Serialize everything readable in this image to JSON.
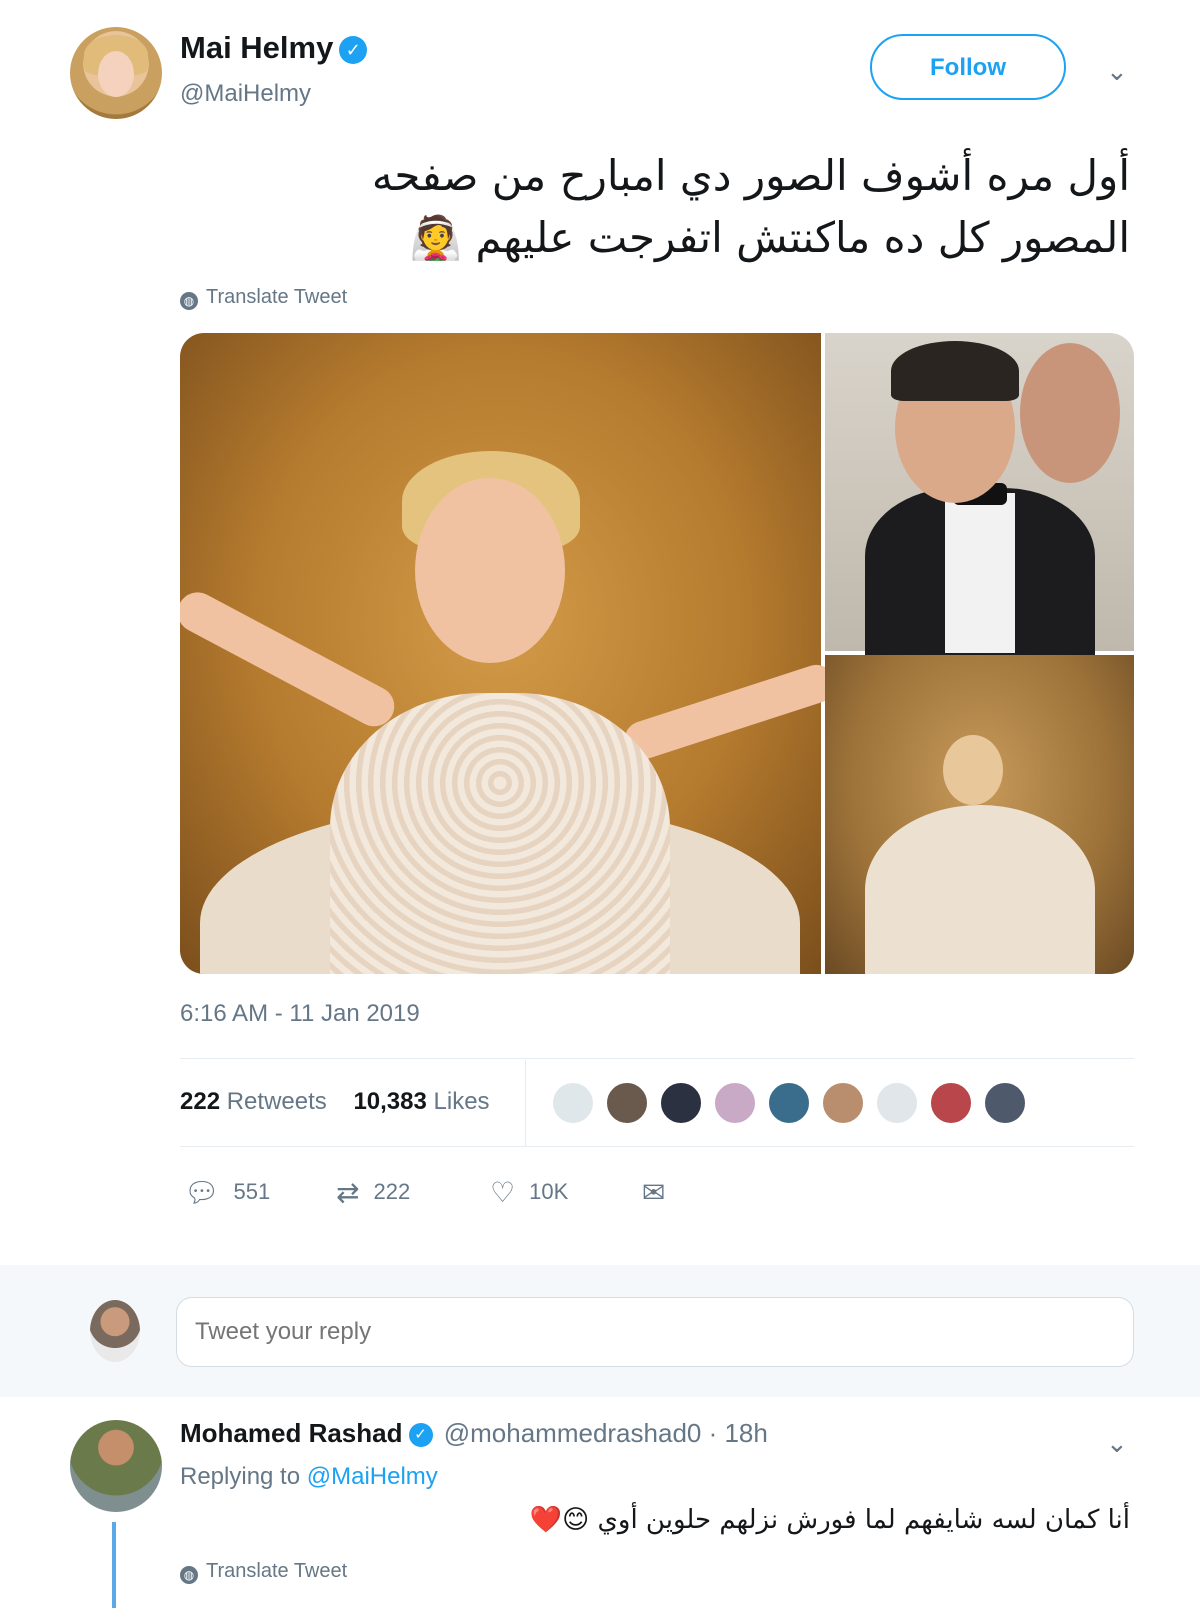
{
  "tweet": {
    "author_name": "Mai Helmy",
    "author_handle": "@MaiHelmy",
    "follow_label": "Follow",
    "text_line1": "أول مره أشوف الصور دي امبارح من صفحه",
    "text_line2": "المصور كل ده ماكنتش اتفرجت عليهم",
    "emoji": "👰",
    "translate_label": "Translate Tweet",
    "timestamp": "6:16 AM - 11 Jan 2019",
    "retweets_count": "222",
    "retweets_label": "Retweets",
    "likes_count": "10,383",
    "likes_label": "Likes",
    "reply_count": "551",
    "retweet_action_count": "222",
    "like_action_count": "10K"
  },
  "reply_box": {
    "placeholder": "Tweet your reply"
  },
  "reply": {
    "author_name": "Mohamed Rashad",
    "author_handle": "@mohammedrashad0 · 18h",
    "replying_to_label": "Replying to",
    "replying_to_handle": "@MaiHelmy",
    "text": "أنا كمان لسه شايفهم لما فورش نزلهم حلوين أوي",
    "emojis": "😊❤️",
    "translate_label": "Translate Tweet"
  },
  "colors": {
    "accent": "#1da1f2",
    "secondary_text": "#657786",
    "reply_bar_bg": "#f5f8fa"
  }
}
